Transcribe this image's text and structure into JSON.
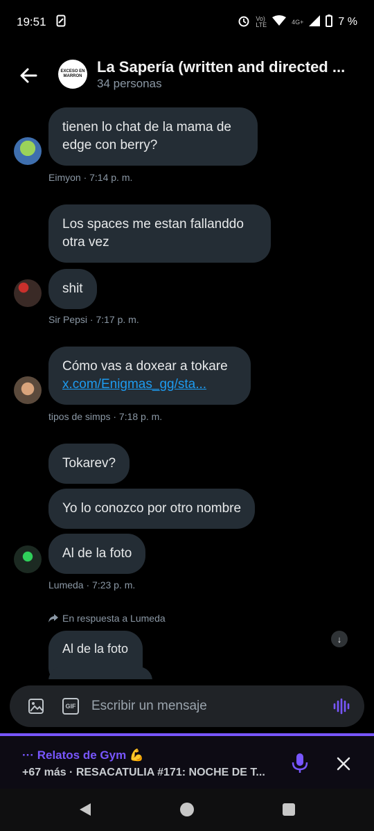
{
  "status_bar": {
    "time": "19:51",
    "network": "4G+",
    "battery": "7 %"
  },
  "header": {
    "title": "La Sapería (written and directed ...",
    "subtitle": "34 personas",
    "avatar_text": "EXCESO EN MARRON"
  },
  "messages": [
    {
      "text": "tienen lo chat de la mama de edge con berry?",
      "meta": "Eimyon · 7:14 p. m."
    },
    {
      "text": "Los spaces me estan fallanddo otra vez"
    },
    {
      "text": "shit",
      "meta": "Sir Pepsi · 7:17 p. m."
    },
    {
      "text": "Cómo vas a doxear a tokare",
      "link": "x.com/Enigmas_gg/sta...",
      "meta": "tipos de simps · 7:18 p. m."
    },
    {
      "text": "Tokarev?"
    },
    {
      "text": "Yo lo conozco por otro nombre"
    },
    {
      "text": "Al de la foto",
      "meta": "Lumeda · 7:23 p. m."
    },
    {
      "reply_to": "En respuesta a Lumeda",
      "text": "Al de la foto"
    }
  ],
  "composer": {
    "placeholder": "Escribir un mensaje",
    "gif_label": "GIF"
  },
  "space": {
    "title": "··· Relatos de Gym 💪",
    "subtitle": "+67 más · RESACATULIA #171: NOCHE DE T..."
  },
  "colors": {
    "accent": "#7856ff",
    "link": "#1d9bf0",
    "bubble": "#242d35",
    "background": "#000000"
  }
}
